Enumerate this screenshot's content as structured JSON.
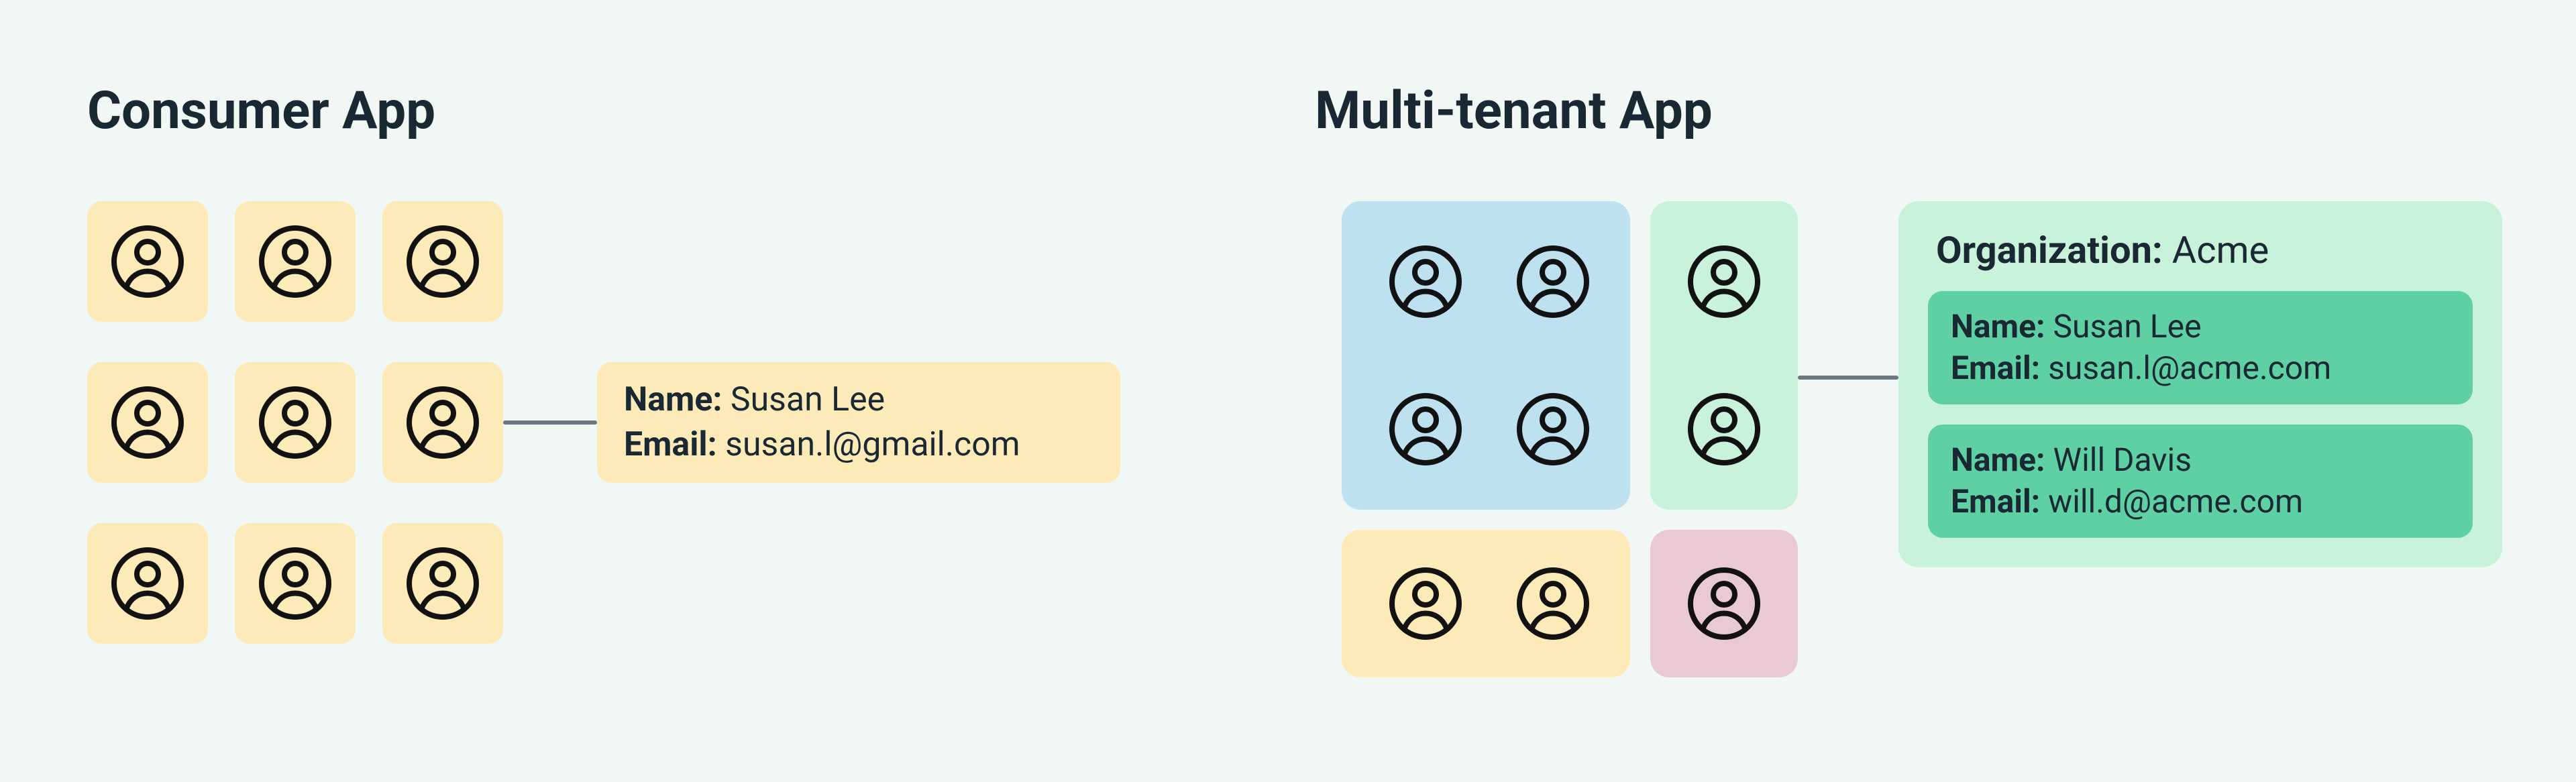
{
  "headings": {
    "consumer": "Consumer App",
    "multitenant": "Multi-tenant App"
  },
  "consumer_card": {
    "name_label": "Name:",
    "name_value": "Susan Lee",
    "email_label": "Email:",
    "email_value": "susan.l@gmail.com"
  },
  "org_card": {
    "org_label": "Organization:",
    "org_value": "Acme",
    "members": [
      {
        "name_label": "Name:",
        "name_value": "Susan Lee",
        "email_label": "Email:",
        "email_value": "susan.l@acme.com"
      },
      {
        "name_label": "Name:",
        "name_value": "Will Davis",
        "email_label": "Email:",
        "email_value": "will.d@acme.com"
      }
    ]
  },
  "colors": {
    "yellow": "#fcebb8",
    "blue": "#bee1ef",
    "green_light": "#c8f3da",
    "green_med": "#5fcfa4",
    "pink": "#e9c9d2",
    "text": "#1a2833",
    "icon_stroke": "#121212"
  },
  "icon_name": "user-icon"
}
